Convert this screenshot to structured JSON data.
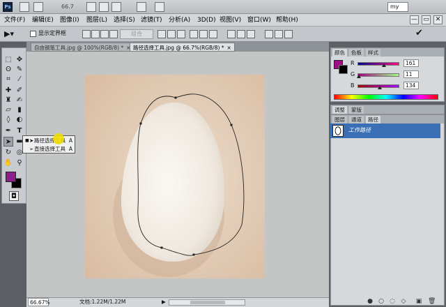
{
  "appbar": {
    "ps_logo": "Ps",
    "zoom": "66.7",
    "workspace": "my"
  },
  "menu": [
    "文件(F)",
    "编辑(E)",
    "图像(I)",
    "图层(L)",
    "选择(S)",
    "滤镜(T)",
    "分析(A)",
    "3D(D)",
    "视图(V)",
    "窗口(W)",
    "帮助(H)"
  ],
  "window_controls": {
    "minimize": "—",
    "restore": "▭",
    "close": "✕"
  },
  "options": {
    "show_bounds_label": "显示定界框",
    "combine_label": "组合"
  },
  "tabs": [
    {
      "label": "自由钢笔工具.jpg @ 100%(RGB/8) *",
      "close": "×"
    },
    {
      "label": "路径选择工具.jpg @ 66.7%(RGB/8) *",
      "close": "×"
    }
  ],
  "flyout": {
    "items": [
      {
        "bullet": "■",
        "label": "路径选择工具",
        "key": "A"
      },
      {
        "bullet": "",
        "label": "直接选择工具",
        "key": "A"
      }
    ]
  },
  "color_panel": {
    "tabs": [
      "颜色",
      "色板",
      "样式"
    ],
    "r": "161",
    "g": "11",
    "b": "134",
    "r_label": "R",
    "g_label": "G",
    "b_label": "B",
    "r_level": 0.63,
    "g_level": 0.04,
    "b_level": 0.53,
    "foreground": "#a10b86"
  },
  "adjust_panel": {
    "tabs": [
      "调整",
      "蒙版"
    ]
  },
  "layers_panel": {
    "tabs": [
      "图层",
      "通道",
      "路径"
    ]
  },
  "paths": [
    {
      "name": "工作路径"
    }
  ],
  "status": {
    "zoom": "66.67%",
    "doc": "文档:1.22M/1.22M",
    "arrow": "▶"
  },
  "colors": {
    "selection_blue": "#3b6fb5",
    "canvas_bg": "#dfc7b2",
    "egg": "#f2ece4"
  }
}
